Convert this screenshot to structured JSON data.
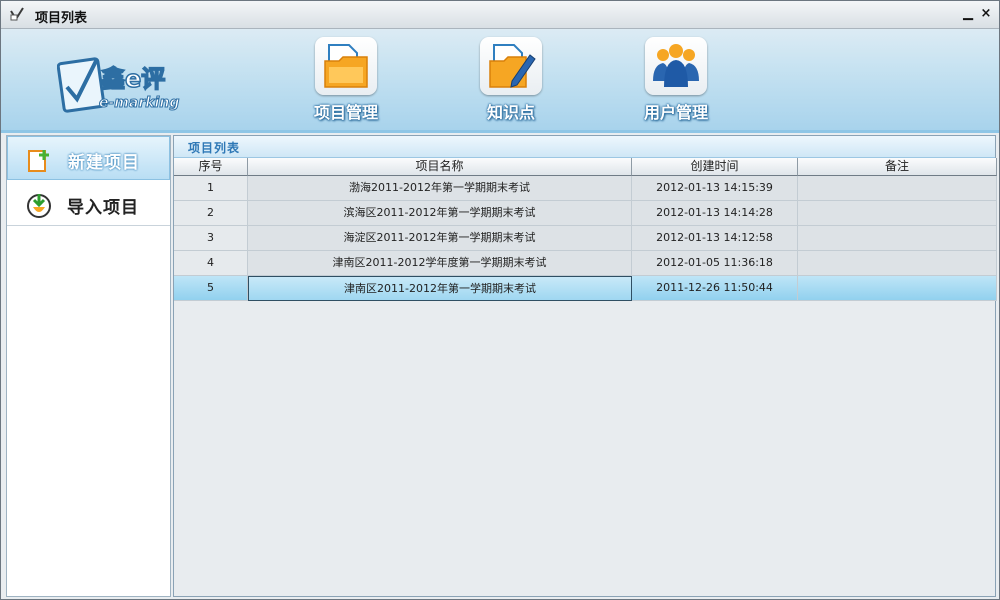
{
  "window": {
    "title": "项目列表",
    "minimize_glyph": "▁",
    "close_glyph": "×"
  },
  "logo": {
    "text_main": "鑫e评",
    "text_sub": "e-marking"
  },
  "nav": [
    {
      "label": "项目管理",
      "icon": "folder-doc-icon"
    },
    {
      "label": "知识点",
      "icon": "folder-pen-icon"
    },
    {
      "label": "用户管理",
      "icon": "users-icon"
    }
  ],
  "sidebar": {
    "items": [
      {
        "label": "新建项目",
        "icon": "new-project-icon",
        "active": true
      },
      {
        "label": "导入项目",
        "icon": "import-project-icon",
        "active": false
      }
    ]
  },
  "panel": {
    "title": "项目列表"
  },
  "table": {
    "columns": [
      "序号",
      "项目名称",
      "创建时间",
      "备注"
    ],
    "rows": [
      {
        "no": "1",
        "name": "渤海2011-2012年第一学期期末考试",
        "created": "2012-01-13 14:15:39",
        "note": ""
      },
      {
        "no": "2",
        "name": "滨海区2011-2012年第一学期期末考试",
        "created": "2012-01-13 14:14:28",
        "note": ""
      },
      {
        "no": "3",
        "name": "海淀区2011-2012年第一学期期末考试",
        "created": "2012-01-13 14:12:58",
        "note": ""
      },
      {
        "no": "4",
        "name": "津南区2011-2012学年度第一学期期末考试",
        "created": "2012-01-05 11:36:18",
        "note": ""
      },
      {
        "no": "5",
        "name": "津南区2011-2012年第一学期期末考试",
        "created": "2011-12-26 11:50:44",
        "note": ""
      }
    ],
    "selected_row": 5
  },
  "colors": {
    "accent": "#2e78b6",
    "banner": "#a8d3ec",
    "selected_row": "#8fd0ee"
  }
}
